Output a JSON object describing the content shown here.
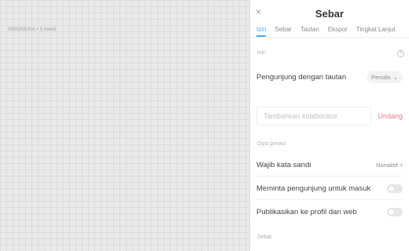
{
  "canvas": {
    "label": "INDONESIA • 3 menit"
  },
  "panel": {
    "title": "Sebar",
    "close_icon": "×",
    "tabs": [
      {
        "label": "Izin",
        "active": true
      },
      {
        "label": "Sebar",
        "active": false
      },
      {
        "label": "Tautan",
        "active": false
      },
      {
        "label": "Ekspor",
        "active": false
      },
      {
        "label": "Tingkat Lanjut",
        "active": false
      }
    ],
    "permission_section": {
      "label": "Izin",
      "link_visitor_label": "Pengunjung dengan tautan",
      "role": "Penulis",
      "role_chevron": "⌄"
    },
    "invite": {
      "placeholder": "Tambahkan kolaborator",
      "button": "Undang"
    },
    "privacy_section": {
      "label": "Opsi privasi",
      "password": {
        "label": "Wajib kata sandi",
        "value": "Nonaktif",
        "chevron": "›"
      },
      "require_login": {
        "label": "Meminta pengunjung untuk masuk",
        "enabled": false
      },
      "publish_profile": {
        "label": "Publikasikan ke profil dan web",
        "enabled": false
      }
    },
    "share_section": {
      "label": "Sebar"
    }
  },
  "colors": {
    "accent": "#4aa8ff",
    "invite_button": "#f07a90"
  }
}
